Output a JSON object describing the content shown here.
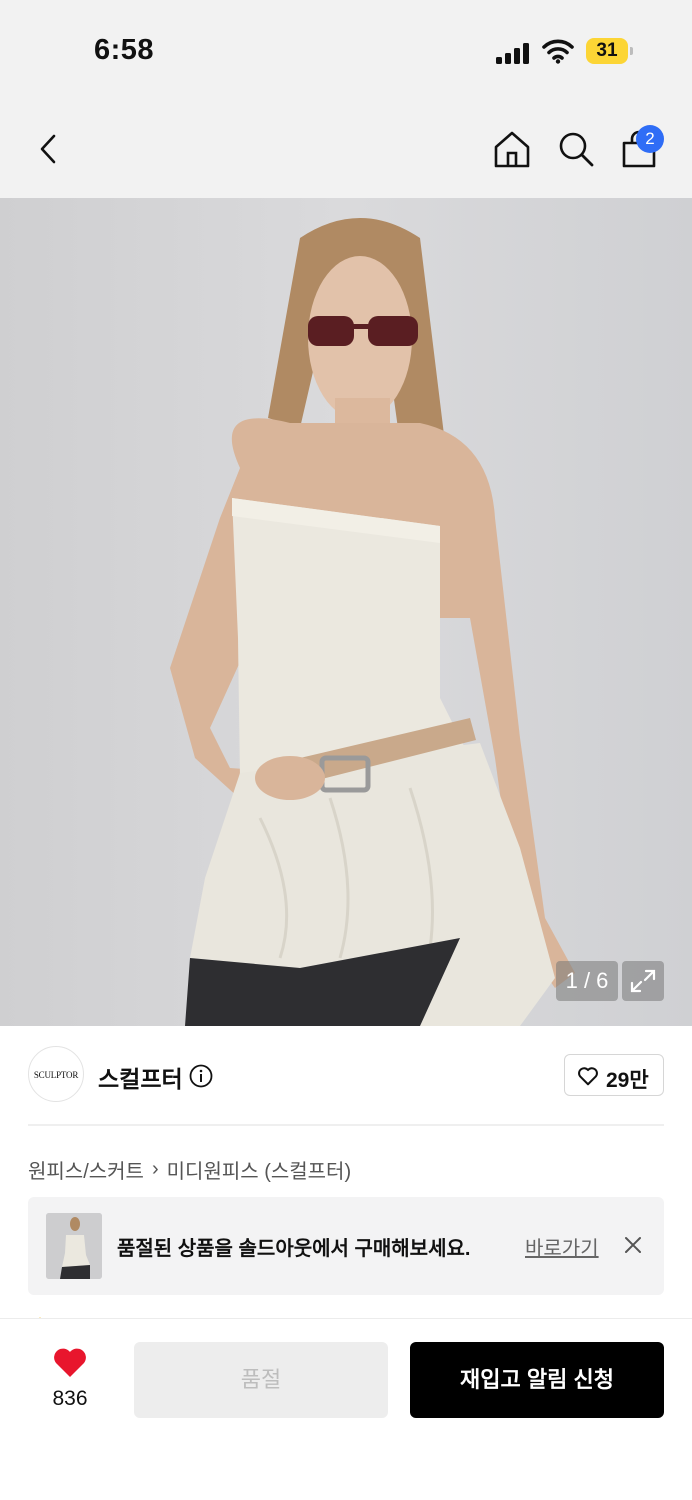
{
  "status_bar": {
    "time": "6:58",
    "battery": "31"
  },
  "nav": {
    "cart_count": "2",
    "icons": [
      "chevron-left-icon",
      "home-icon",
      "search-icon",
      "shopping-bag-icon"
    ]
  },
  "gallery": {
    "counter": "1 / 6"
  },
  "brand": {
    "logo_text": "SCULPTOR",
    "name": "스컬프터",
    "likes": "29만"
  },
  "breadcrumb": {
    "category": "원피스/스커트",
    "separator": "›",
    "subcategory": "미디원피스 (스컬프터)"
  },
  "soldout_banner": {
    "message": "품절된 상품을 솔드아웃에서 구매해보세요.",
    "link": "바로가기"
  },
  "bottom_bar": {
    "wish_count": "836",
    "soldout_label": "품절",
    "restock_label": "재입고 알림 신청"
  },
  "colors": {
    "accent_blue": "#2f6df6",
    "heart_red": "#e8162d",
    "battery_yellow": "#fcd535",
    "primary_black": "#000000"
  }
}
